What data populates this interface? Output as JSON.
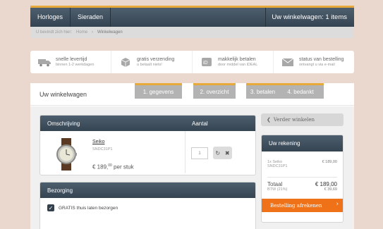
{
  "topnav": {
    "items": [
      "Horloges",
      "Sieraden"
    ],
    "cart": "Uw winkelwagen: 1 items"
  },
  "breadcrumb": {
    "lead": "U bevindt zich hier:",
    "home": "Home",
    "sep": "›",
    "current": "Winkelwagen"
  },
  "usps": [
    {
      "icon": "truck-icon",
      "title": "snelle levertijd",
      "sub": "binnen 1-2 werkdagen"
    },
    {
      "icon": "box-icon",
      "title": "gratis verzending",
      "sub": "u betaalt niets!"
    },
    {
      "icon": "ideal-icon",
      "title": "makkelijk betalen",
      "sub": "door middel van iDEAL"
    },
    {
      "icon": "mail-icon",
      "title": "status van bestelling",
      "sub": "ontvangt u via e-mail"
    }
  ],
  "panel_title": "Uw winkelwagen",
  "steps": [
    "1. gegevens",
    "2. overzicht",
    "3. betalen",
    "4. bedankt"
  ],
  "cart": {
    "col_desc": "Omschrijving",
    "col_qty": "Aantal",
    "product": {
      "name": "Seiko",
      "sku": "SNDC31P1",
      "price_main": "€ 189,",
      "price_cents": "00",
      "price_unit": "per stuk"
    },
    "qty": "1",
    "refresh_icon": "↻",
    "remove_icon": "✖"
  },
  "shipping": {
    "title": "Bezorging",
    "option": "GRATIS thuis laten bezorgen"
  },
  "continue": {
    "arrow": "❮",
    "label": "Verder winkelen"
  },
  "account": {
    "title": "Uw rekening",
    "line_item": "1x Seiko",
    "line_sku": "SNDC31P1",
    "line_price": "€ 189,00",
    "total_label": "Totaal",
    "total_value": "€ 189,00",
    "vat_label": "BTW (21%)",
    "vat_value": "€ 39,69",
    "checkout": "Bestelling afrekenen",
    "checkout_arrow": "›"
  },
  "colors": {
    "accent": "#f07218",
    "header": "#3d4c59",
    "highlight": "#e6a93a"
  }
}
